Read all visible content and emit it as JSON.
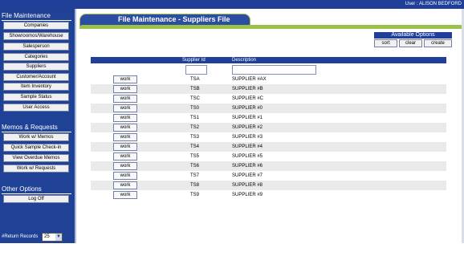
{
  "user_text": "User : ALISON BEDFORD",
  "page_title": "File Maintenance - Suppliers File",
  "sidebar": {
    "file_maintenance": {
      "title": "File Maintenance",
      "items": [
        "Companies",
        "Showroomos/Warehouse",
        "Salesperson",
        "Categories",
        "Suppliers",
        "Customer/Account",
        "Item Inventory",
        "Sample Status",
        "User Access"
      ]
    },
    "memos_requests": {
      "title": "Memos & Requests",
      "items": [
        "Work w/ Memos",
        "Quick Sample Check-in",
        "View Overdue Memos",
        "Work w/ Requests"
      ]
    },
    "other_options": {
      "title": "Other Options",
      "items": [
        "Log Off"
      ]
    },
    "return_records_label": "#Return Records",
    "return_records_value": "25"
  },
  "options": {
    "title": "Available Options",
    "sort": "sort",
    "clear": "clear",
    "create": "create"
  },
  "table": {
    "headers": {
      "id": "Supplier Id",
      "desc": "Description"
    },
    "work_label": "work",
    "rows": [
      {
        "id": "TSA",
        "desc": "SUPPLIER #AX"
      },
      {
        "id": "TSB",
        "desc": "SUPPLIER #B"
      },
      {
        "id": "TSC",
        "desc": "SUPPLIER #C"
      },
      {
        "id": "TS0",
        "desc": "SUPPLIER #0"
      },
      {
        "id": "TS1",
        "desc": "SUPPLIER #1"
      },
      {
        "id": "TS2",
        "desc": "SUPPLIER #2"
      },
      {
        "id": "TS3",
        "desc": "SUPPLIER #3"
      },
      {
        "id": "TS4",
        "desc": "SUPPLIER #4"
      },
      {
        "id": "TS5",
        "desc": "SUPPLIER #5"
      },
      {
        "id": "TS6",
        "desc": "SUPPLIER #6"
      },
      {
        "id": "TS7",
        "desc": "SUPPLIER #7"
      },
      {
        "id": "TS8",
        "desc": "SUPPLIER #8"
      },
      {
        "id": "TS9",
        "desc": "SUPPLIER #9"
      }
    ]
  },
  "colors": {
    "navy": "#1f3f99",
    "green_accent": "#9ac24a",
    "row_alt": "#eaeaea"
  }
}
